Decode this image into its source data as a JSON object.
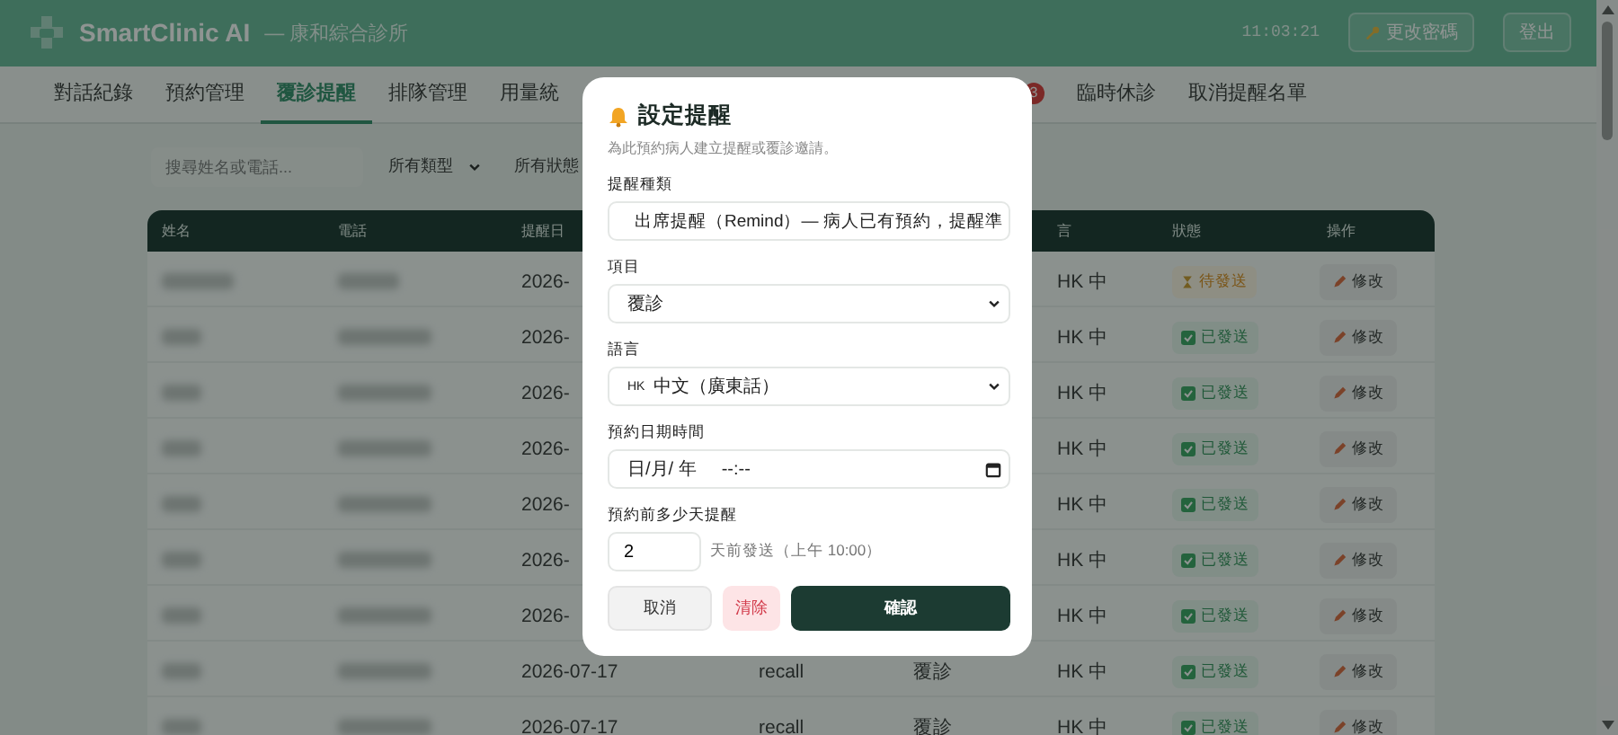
{
  "header": {
    "brand": "SmartClinic AI",
    "clinic": "— 康和綜合診所",
    "time": "11:03:21",
    "buttons": [
      {
        "kind": "key",
        "label": "更改密碼"
      },
      {
        "kind": "plain",
        "label": "登出"
      }
    ]
  },
  "tabs": [
    {
      "label": "對話紀錄",
      "selected": false
    },
    {
      "label": "預約管理",
      "selected": false
    },
    {
      "label": "覆診提醒",
      "selected": true
    },
    {
      "label": "排隊管理",
      "selected": false
    },
    {
      "label": "用量統",
      "selected": false
    },
    {
      "badge": "3"
    },
    {
      "label": "臨時休診",
      "selected": false
    },
    {
      "label": "取消提醒名單",
      "selected": false
    }
  ],
  "filters": {
    "search": {
      "placeholder": "搜尋姓名或電話..."
    },
    "selects": [
      {
        "value": "所有類型",
        "caret": true
      },
      {
        "value": "所有狀態",
        "caret": false
      }
    ]
  },
  "table": {
    "columns": [
      {
        "kind": "name",
        "label": "姓名"
      },
      {
        "kind": "phone",
        "label": "電話"
      },
      {
        "kind": "date",
        "label": "提醒日"
      },
      {
        "kind": "language",
        "label": "言"
      },
      {
        "kind": "status",
        "label": "狀態"
      },
      {
        "kind": "action",
        "label": "操作"
      }
    ],
    "rows": [
      {
        "date": "2026-",
        "language": "HK 中",
        "status": {
          "kind": "pending",
          "label": "待發送"
        },
        "action": "修改"
      },
      {
        "date": "2026-",
        "language": "HK 中",
        "status": {
          "kind": "sent",
          "label": "已發送"
        },
        "action": "修改"
      },
      {
        "date": "2026-",
        "language": "HK 中",
        "status": {
          "kind": "sent",
          "label": "已發送"
        },
        "action": "修改"
      },
      {
        "date": "2026-",
        "language": "HK 中",
        "status": {
          "kind": "sent",
          "label": "已發送"
        },
        "action": "修改"
      },
      {
        "date": "2026-",
        "language": "HK 中",
        "status": {
          "kind": "sent",
          "label": "已發送"
        },
        "action": "修改"
      },
      {
        "date": "2026-",
        "language": "HK 中",
        "status": {
          "kind": "sent",
          "label": "已發送"
        },
        "action": "修改"
      },
      {
        "date": "2026-",
        "language": "HK 中",
        "status": {
          "kind": "sent",
          "label": "已發送"
        },
        "action": "修改"
      },
      {
        "date": "2026-07-17",
        "type": "recall",
        "item": "覆診",
        "language": "HK 中",
        "status": {
          "kind": "sent",
          "label": "已發送"
        },
        "action": "修改"
      },
      {
        "date": "2026-07-17",
        "type": "recall",
        "item": "覆診",
        "language": "HK 中",
        "status": {
          "kind": "sent",
          "label": "已發送"
        },
        "action": "修改"
      }
    ]
  },
  "modal": {
    "title": "設定提醒",
    "subtitle": "為此預約病人建立提醒或覆診邀請。",
    "fields": [
      {
        "kind": "alarm-select",
        "label": "提醒種類",
        "value": "出席提醒（Remind）— 病人已有預約，提醒準"
      },
      {
        "kind": "select",
        "label": "項目",
        "value": "覆診"
      },
      {
        "kind": "select",
        "label": "語言",
        "prefix": "HK",
        "value": "中文（廣東話）"
      },
      {
        "kind": "datetime",
        "label": "預約日期時間",
        "date": "日/月/ 年",
        "time": "--:--"
      },
      {
        "kind": "days",
        "label": "預約前多少天提醒",
        "value": "2",
        "note": "天前發送（上午 10:00）"
      }
    ],
    "buttons": [
      {
        "kind": "cancel",
        "label": "取消"
      },
      {
        "kind": "clear",
        "label": "清除"
      },
      {
        "kind": "confirm",
        "label": "確認"
      }
    ]
  }
}
